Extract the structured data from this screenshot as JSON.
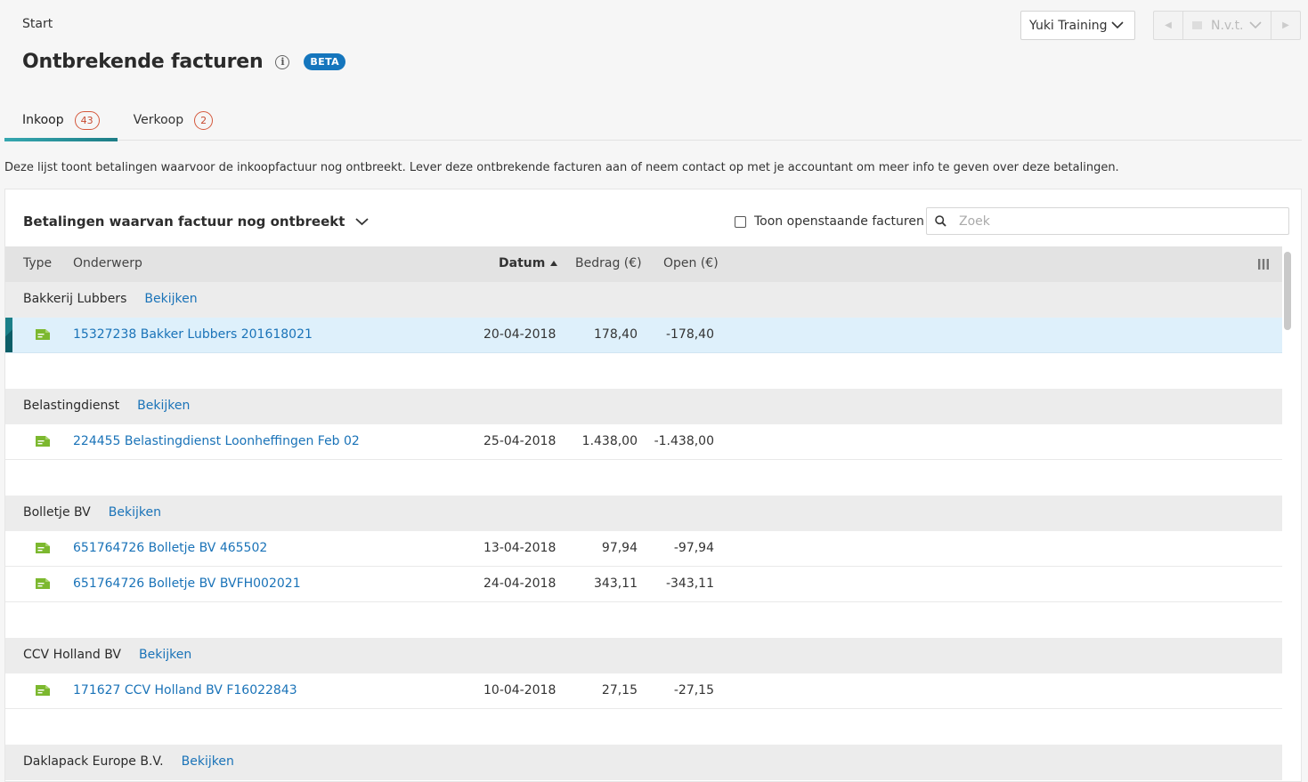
{
  "breadcrumb": "Start",
  "page": {
    "title": "Ontbrekende facturen",
    "beta": "BETA"
  },
  "header": {
    "org_select": "Yuki Training",
    "period": "N.v.t."
  },
  "tabs": [
    {
      "label": "Inkoop",
      "count": "43"
    },
    {
      "label": "Verkoop",
      "count": "2"
    }
  ],
  "description": "Deze lijst toont betalingen waarvoor de inkoopfactuur nog ontbreekt. Lever deze ontbrekende facturen aan of neem contact op met je accountant om meer info te geven over deze betalingen.",
  "panel": {
    "view_title": "Betalingen waarvan factuur nog ontbreekt",
    "toggle_label": "Toon openstaande facturen",
    "search_placeholder": "Zoek"
  },
  "table": {
    "columns": {
      "type": "Type",
      "onderwerp": "Onderwerp",
      "datum": "Datum",
      "bedrag": "Bedrag (€)",
      "open": "Open (€)"
    },
    "view_link": "Bekijken",
    "groups": [
      {
        "name": "Bakkerij Lubbers",
        "rows": [
          {
            "subject": "15327238 Bakker Lubbers 201618021",
            "date": "20-04-2018",
            "amount": "178,40",
            "open": "-178,40"
          }
        ]
      },
      {
        "name": "Belastingdienst",
        "rows": [
          {
            "subject": "224455 Belastingdienst Loonheffingen Feb 02",
            "date": "25-04-2018",
            "amount": "1.438,00",
            "open": "-1.438,00"
          }
        ]
      },
      {
        "name": "Bolletje BV",
        "rows": [
          {
            "subject": "651764726 Bolletje BV 465502",
            "date": "13-04-2018",
            "amount": "97,94",
            "open": "-97,94"
          },
          {
            "subject": "651764726 Bolletje BV BVFH002021",
            "date": "24-04-2018",
            "amount": "343,11",
            "open": "-343,11"
          }
        ]
      },
      {
        "name": "CCV Holland BV",
        "rows": [
          {
            "subject": "171627 CCV Holland BV F16022843",
            "date": "10-04-2018",
            "amount": "27,15",
            "open": "-27,15"
          }
        ]
      },
      {
        "name": "Daklapack Europe B.V.",
        "rows": []
      }
    ]
  },
  "colors": {
    "accent_teal": "#1d7d86",
    "link_blue": "#1a73b8",
    "badge_blue": "#1576bd",
    "count_red": "#d4573b",
    "doc_icon_green": "#7cb82f",
    "selected_row": "#def0fb"
  }
}
